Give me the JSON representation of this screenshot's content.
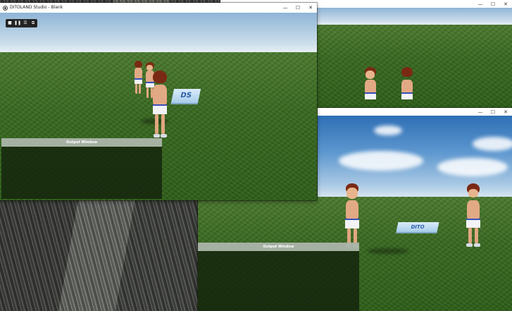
{
  "main_window": {
    "title": "DITOLAND Studio - Blank",
    "controls": {
      "minimize": "—",
      "maximize": "☐",
      "close": "✕"
    },
    "toolbar": [
      {
        "name": "stop-button",
        "glyph": "■"
      },
      {
        "name": "pause-button",
        "glyph": "❚❚"
      },
      {
        "name": "list-button",
        "glyph": "☰"
      },
      {
        "name": "window-button",
        "glyph": "⧉"
      }
    ],
    "output_title": "Output Window",
    "sign_text": "DS"
  },
  "back_window": {
    "controls": {
      "minimize": "—",
      "maximize": "☐",
      "close": "✕"
    }
  },
  "right_window": {
    "controls": {
      "minimize": "—",
      "maximize": "☐",
      "close": "✕"
    },
    "sign_text": "DITO",
    "output_title": "Output Window"
  }
}
